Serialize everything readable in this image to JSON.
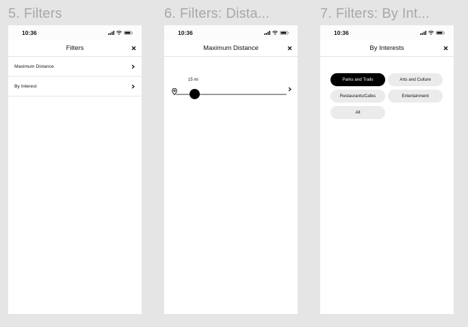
{
  "frames": [
    {
      "title": "5. Filters",
      "status_time": "10:36",
      "nav_title": "Filters",
      "rows": [
        {
          "label": "Maximum Distance"
        },
        {
          "label": "By Interest"
        }
      ]
    },
    {
      "title": "6. Filters: Dista...",
      "status_time": "10:36",
      "nav_title": "Maximum Distance",
      "distance_label": "15 mi",
      "slider_value_fraction": 0.17
    },
    {
      "title": "7. Filters: By Int...",
      "status_time": "10:36",
      "nav_title": "By Interests",
      "chips": [
        {
          "label": "Parks and Trails",
          "selected": true
        },
        {
          "label": "Arts and Culture",
          "selected": false
        },
        {
          "label": "Restaurants/Cafes",
          "selected": false
        },
        {
          "label": "Entertainment",
          "selected": false
        },
        {
          "label": "All",
          "selected": false
        }
      ]
    }
  ],
  "colors": {
    "background": "#e5e5e5",
    "title_gray": "#a8a8a8",
    "accent": "#000000",
    "chip_bg": "#ebebeb"
  },
  "icons": [
    "signal-icon",
    "wifi-icon",
    "battery-icon",
    "close-icon",
    "chevron-right-icon",
    "location-pin-icon"
  ]
}
